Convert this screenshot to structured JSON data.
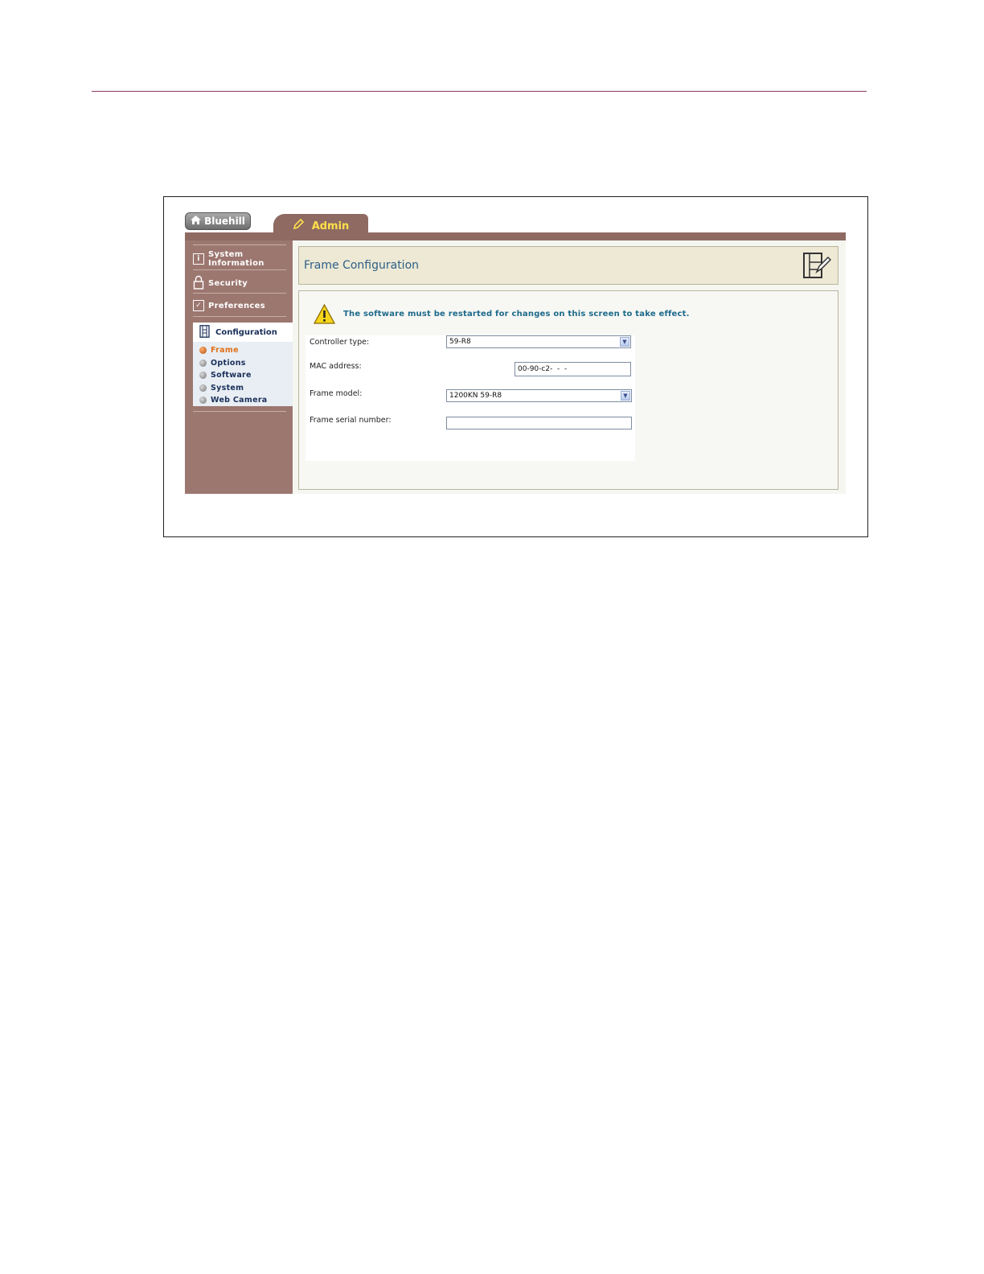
{
  "tabs": {
    "home_label": "Bluehill",
    "admin_label": "Admin"
  },
  "sidebar": {
    "items": [
      {
        "label_line1": "System",
        "label_line2": "Information"
      },
      {
        "label": "Security"
      },
      {
        "label": "Preferences"
      }
    ],
    "configuration": {
      "label": "Configuration",
      "subitems": [
        "Frame",
        "Options",
        "Software",
        "System",
        "Web Camera"
      ],
      "active": "Frame"
    }
  },
  "main": {
    "title": "Frame Configuration",
    "warning": "The software must be restarted for changes on this screen to take effect.",
    "fields": {
      "controller_type": {
        "label": "Controller type:",
        "value": "59-R8"
      },
      "mac_address": {
        "label": "MAC address:",
        "value": "00-90-c2-  -  -"
      },
      "frame_model": {
        "label": "Frame model:",
        "value": "1200KN 59-R8"
      },
      "frame_serial": {
        "label": "Frame serial number:",
        "value": ""
      }
    }
  },
  "colors": {
    "sidebar": "#9c7770",
    "accent": "#ffe04a",
    "title": "#2e5f86",
    "active_bullet": "#b34d0a"
  }
}
